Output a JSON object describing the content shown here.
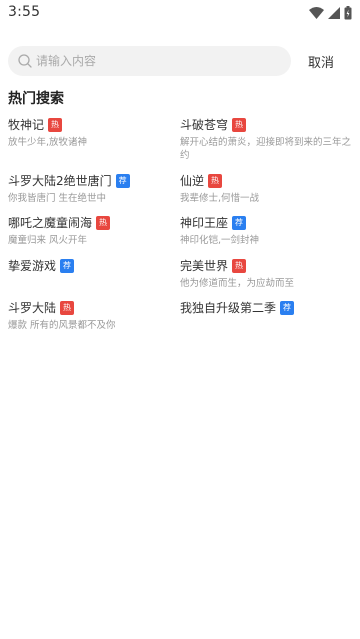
{
  "status_bar": {
    "time": "3:55",
    "icons": [
      "wifi-icon",
      "signal-icon",
      "battery-charging-icon"
    ]
  },
  "search": {
    "placeholder": "请输入内容",
    "value": "",
    "cancel_label": "取消"
  },
  "hot_section": {
    "title": "热门搜索",
    "badge_colors": {
      "hot": "#e8473f",
      "recommend": "#2a7ff0"
    },
    "items": [
      {
        "name": "牧神记",
        "badge": "热",
        "badge_type": "hot",
        "desc": "放牛少年,放牧诸神"
      },
      {
        "name": "斗破苍穹",
        "badge": "热",
        "badge_type": "hot",
        "desc": "解开心结的萧炎，迎接即将到来的三年之约"
      },
      {
        "name": "斗罗大陆2绝世唐门",
        "badge": "荐",
        "badge_type": "recommend",
        "desc": "你我皆唐门 生在绝世中"
      },
      {
        "name": "仙逆",
        "badge": "热",
        "badge_type": "hot",
        "desc": "我辈修士,何惜一战"
      },
      {
        "name": "哪吒之魔童闹海",
        "badge": "热",
        "badge_type": "hot",
        "desc": "魔童归来 风火开年"
      },
      {
        "name": "神印王座",
        "badge": "荐",
        "badge_type": "recommend",
        "desc": "神印化铠,一剑封神"
      },
      {
        "name": "挚爱游戏",
        "badge": "荐",
        "badge_type": "recommend",
        "desc": ""
      },
      {
        "name": "完美世界",
        "badge": "热",
        "badge_type": "hot",
        "desc": "他为修道而生，为应劫而至"
      },
      {
        "name": "斗罗大陆",
        "badge": "热",
        "badge_type": "hot",
        "desc": "爆款 所有的风景都不及你"
      },
      {
        "name": "我独自升级第二季",
        "badge": "荐",
        "badge_type": "recommend",
        "desc": ""
      }
    ]
  }
}
